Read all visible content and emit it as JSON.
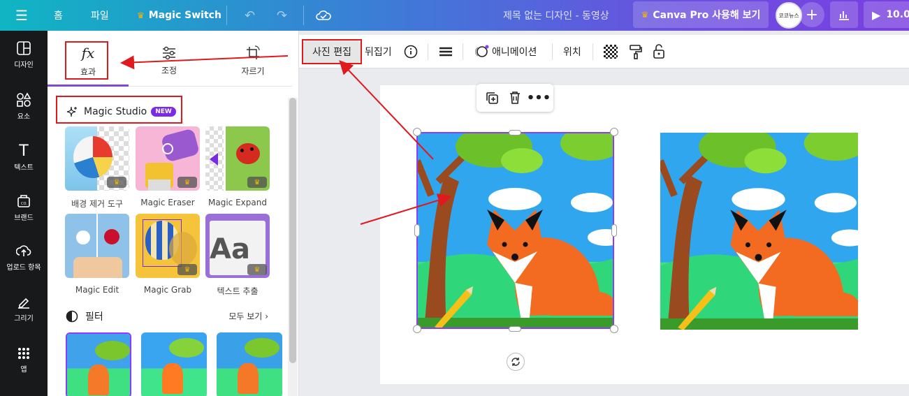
{
  "topbar": {
    "menu_icon": "hamburger-icon",
    "home": "홈",
    "file": "파일",
    "magic_switch": "Magic Switch",
    "design_title": "제목 없는 디자인 - 동영상",
    "pro_button": "Canva Pro 사용해 보기",
    "avatar_text": "코코뉴스",
    "play_label": "10.0"
  },
  "rail": {
    "items": [
      {
        "label": "디자인",
        "icon": "layout-icon"
      },
      {
        "label": "요소",
        "icon": "shapes-icon"
      },
      {
        "label": "텍스트",
        "icon": "text-icon"
      },
      {
        "label": "브랜드",
        "icon": "brand-icon"
      },
      {
        "label": "업로드 항목",
        "icon": "upload-icon"
      },
      {
        "label": "그리기",
        "icon": "draw-icon"
      },
      {
        "label": "앱",
        "icon": "apps-icon"
      }
    ]
  },
  "panel": {
    "tabs": [
      {
        "label": "효과",
        "icon": "fx"
      },
      {
        "label": "조정",
        "icon": "sliders-icon"
      },
      {
        "label": "자르기",
        "icon": "crop-icon"
      }
    ],
    "magic_studio": "Magic Studio",
    "new_badge": "NEW",
    "tools": [
      {
        "label": "배경 제거 도구"
      },
      {
        "label": "Magic Eraser"
      },
      {
        "label": "Magic Expand"
      },
      {
        "label": "Magic Edit"
      },
      {
        "label": "Magic Grab"
      },
      {
        "label": "텍스트 추출"
      }
    ],
    "filter_title": "필터",
    "see_all": "모두 보기"
  },
  "toolbar": {
    "edit_photo": "사진 편집",
    "flip": "뒤집기",
    "animate": "애니메이션",
    "position": "위치"
  },
  "colors": {
    "accent": "#8b3dff",
    "annotation_red": "#e0191f",
    "rail_bg": "#18191b"
  }
}
